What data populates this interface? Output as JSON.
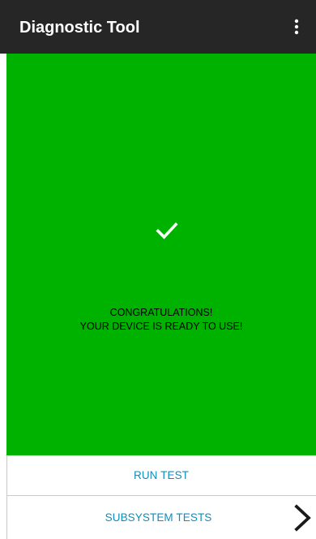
{
  "app_bar": {
    "title": "Diagnostic Tool",
    "menu_icon": "more-vertical-icon"
  },
  "status": {
    "icon": "check-icon",
    "background_color": "#00b200",
    "line1": "CONGRATULATIONS!",
    "line2": "YOUR DEVICE IS READY TO USE!"
  },
  "actions": {
    "run_test_label": "RUN TEST",
    "subsystem_tests_label": "SUBSYSTEM TESTS",
    "subsystem_icon": "chevron-right-icon",
    "label_color": "#0a8fc0"
  }
}
